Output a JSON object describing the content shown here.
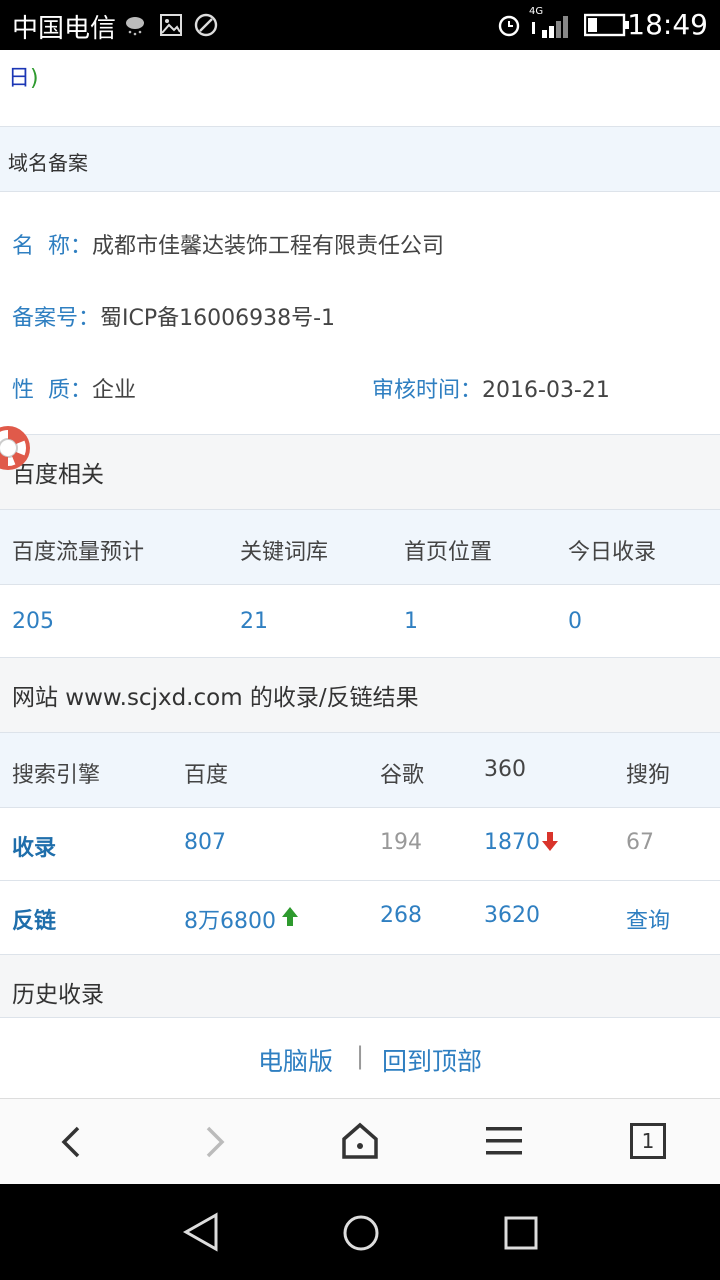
{
  "status_bar": {
    "carrier": "中国电信",
    "network": "4G",
    "time": "18:49"
  },
  "top_fragment": {
    "char": "日",
    "paren": ")"
  },
  "domain_record": {
    "header": "域名备案",
    "name_label": "名  称：",
    "name_value": "成都市佳馨达装饰工程有限责任公司",
    "icp_label": "备案号：",
    "icp_value": "蜀ICP备16006938号-1",
    "nature_label": "性  质：",
    "nature_value": "企业",
    "review_label": "审核时间：",
    "review_value": "2016-03-21"
  },
  "baidu": {
    "header": "百度相关",
    "columns": [
      "百度流量预计",
      "关键词库",
      "首页位置",
      "今日收录"
    ],
    "values": [
      "205",
      "21",
      "1",
      "0"
    ]
  },
  "index_result": {
    "header": "网站 www.scjxd.com 的收录/反链结果",
    "columns": [
      "搜索引擎",
      "百度",
      "谷歌",
      "360",
      "搜狗"
    ],
    "rows": [
      {
        "label": "收录",
        "baidu": "807",
        "google": "194",
        "s360": "1870",
        "sogou": "67"
      },
      {
        "label": "反链",
        "baidu": "8万6800",
        "google": "268",
        "s360": "3620",
        "sogou": "查询"
      }
    ],
    "down_color": "#d9342b",
    "up_color": "#2e9a2e"
  },
  "history": {
    "header": "历史收录"
  },
  "footer": {
    "pc_link": "电脑版",
    "separator": "|",
    "top_link": "回到顶部"
  },
  "browser_nav": {
    "tabs_count": "1"
  },
  "colors": {
    "link_blue": "#2f7fc1",
    "band_blue": "#f0f6fc",
    "band_gray": "#f5f6f7"
  }
}
